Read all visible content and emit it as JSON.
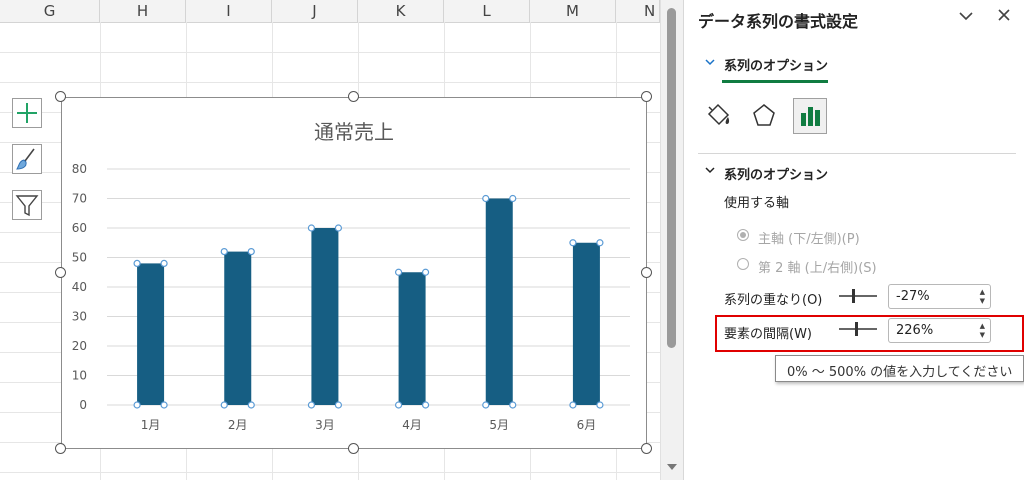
{
  "sheet": {
    "columns": [
      "G",
      "H",
      "I",
      "J",
      "K",
      "L",
      "M",
      "N"
    ]
  },
  "chart_tools": {
    "add_element_icon": "plus-icon",
    "style_icon": "brush-icon",
    "filter_icon": "filter-icon"
  },
  "chart_data": {
    "type": "bar",
    "title": "通常売上",
    "categories": [
      "1月",
      "2月",
      "3月",
      "4月",
      "5月",
      "6月"
    ],
    "values": [
      48,
      52,
      60,
      45,
      70,
      55
    ],
    "ylim": [
      0,
      80
    ],
    "yticks": [
      "0",
      "10",
      "20",
      "30",
      "40",
      "50",
      "60",
      "70",
      "80"
    ],
    "grid": true,
    "bar_color": "#165e83",
    "selected": true
  },
  "pane": {
    "title": "データ系列の書式設定",
    "tab_label": "系列のオプション",
    "section_title": "系列のオプション",
    "axis_label": "使用する軸",
    "primary_axis": "主軸 (下/左側)(P)",
    "secondary_axis": "第 2 軸 (上/右側)(S)",
    "overlap_label": "系列の重なり(O)",
    "overlap_value": "-27%",
    "gap_label": "要素の間隔(W)",
    "gap_value": "226%",
    "tooltip": "0% ～ 500% の値を入力してください",
    "icons": [
      "fill-line-icon",
      "effects-pentagon-icon",
      "series-options-bar-icon"
    ],
    "accent_color": "#107c41",
    "highlight_color": "#e00000"
  }
}
